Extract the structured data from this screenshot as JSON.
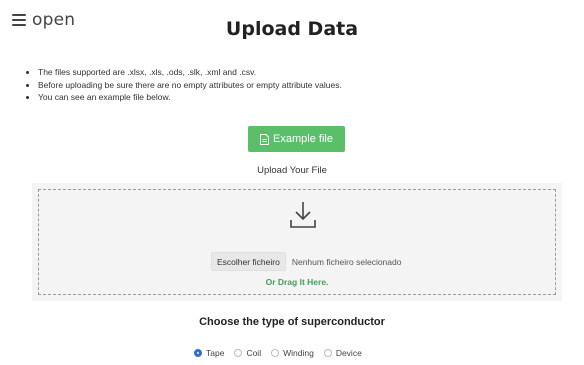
{
  "header": {
    "brand": "open",
    "title": "Upload Data"
  },
  "instructions": [
    "The files supported are .xlsx, .xls, .ods, .slk, .xml and .csv.",
    "Before uploading be sure there are no empty attributes or empty attribute values.",
    "You can see an example file below."
  ],
  "example_button": {
    "label": "Example file",
    "color": "#5bbf6a"
  },
  "upload": {
    "label": "Upload Your File",
    "choose_label": "Escolher ficheiro",
    "no_file": "Nenhum ficheiro selecionado",
    "drag_text": "Or Drag It Here."
  },
  "superconductor": {
    "title": "Choose the type of superconductor",
    "options": [
      "Tape",
      "Coil",
      "Winding",
      "Device"
    ],
    "selected": "Tape"
  },
  "colors": {
    "accent_green": "#5bbf6a",
    "radio_selected": "#2f6fd8"
  }
}
